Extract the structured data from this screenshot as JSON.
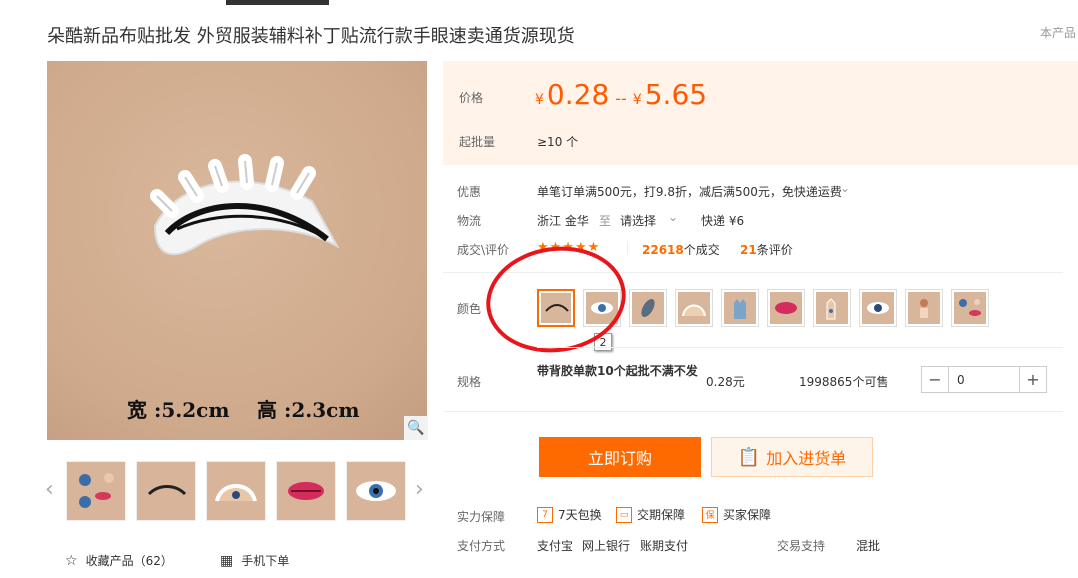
{
  "title": "朵酷新品布贴批发 外贸服装辅料补丁贴流行款手眼速卖通货源现货",
  "top_right": "本产品",
  "main_image": {
    "width_text": "宽 :5.2cm",
    "height_text": "高 :2.3cm"
  },
  "thumbnails": [
    "mixed-patches",
    "eyelash-patch",
    "hand-eye-patch",
    "lips-patch",
    "evil-eye-patch"
  ],
  "price": {
    "label": "价格",
    "symbol": "¥",
    "low": "0.28",
    "dash": "--",
    "high": "5.65"
  },
  "moq": {
    "label": "起批量",
    "value": "≥10 个"
  },
  "promo": {
    "label": "优惠",
    "value": "单笔订单满500元，打9.8折，减后满500元，免快递运费"
  },
  "logistics": {
    "label": "物流",
    "origin": "浙江 金华",
    "to": "至",
    "select": "请选择",
    "express": "快递 ¥6"
  },
  "deals": {
    "label": "成交\\评价",
    "stars": "★★★★★",
    "count": "22618",
    "count_suffix": "个成交",
    "reviews": "21",
    "reviews_suffix": "条评价"
  },
  "color": {
    "label": "颜色",
    "swatches": [
      "eyelash",
      "evil-eye",
      "leaf",
      "hands",
      "hamsa",
      "lips",
      "hand",
      "eye",
      "figure",
      "mixed"
    ],
    "tooltip": "2"
  },
  "spec": {
    "label": "规格",
    "name": "带背胶单款10个起批不满不发",
    "price": "0.28元",
    "stock": "1998865个可售",
    "qty": "0",
    "minus": "−",
    "plus": "+"
  },
  "buttons": {
    "buy": "立即订购",
    "cart": "加入进货单"
  },
  "guarantee": {
    "label": "实力保障",
    "items": [
      "7天包换",
      "交期保障",
      "买家保障"
    ]
  },
  "payment": {
    "label": "支付方式",
    "items": [
      "支付宝",
      "网上银行",
      "账期支付"
    ],
    "trade_label": "交易支持",
    "trade_value": "混批"
  },
  "footer": {
    "collect": "收藏产品（62）",
    "mobile": "手机下单"
  },
  "colors": {
    "accent": "#ff6a00",
    "price_bg": "#fff3ea",
    "circle": "#e8151b"
  }
}
